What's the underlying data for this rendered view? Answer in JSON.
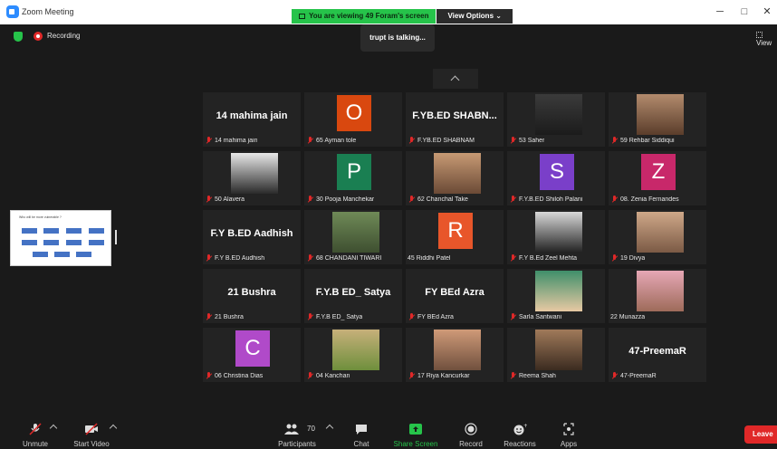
{
  "window": {
    "title": "Zoom Meeting",
    "viewing_text": "You are viewing 49 Foram's screen",
    "view_options_label": "View Options ⌄",
    "minimize": "─",
    "maximize": "□",
    "close": "✕"
  },
  "meeting": {
    "recording_label": "Recording",
    "view_label": "View",
    "talking_text": "trupt is talking..."
  },
  "shared_screen": {
    "slide_title": "Who will be more vulnerable ?"
  },
  "tiles": [
    {
      "type": "name",
      "display": "14 mahima jain",
      "label": "14 mahima jain"
    },
    {
      "type": "avatar",
      "letter": "O",
      "color": "#d9480f",
      "label": "65 Ayman tole"
    },
    {
      "type": "name",
      "display": "F.YB.ED SHABN...",
      "label": "F.YB.ED SHABNAM"
    },
    {
      "type": "photo",
      "photo_colors": [
        "#3b3b3b",
        "#1b1b1b"
      ],
      "label": "53 Saher"
    },
    {
      "type": "photo",
      "photo_colors": [
        "#b38b6d",
        "#5a3d2b"
      ],
      "label": "59 Rehbar Siddiqui"
    },
    {
      "type": "photo",
      "photo_colors": [
        "#e8e8e8",
        "#2a2a2a"
      ],
      "label": "50 Alavera"
    },
    {
      "type": "avatar",
      "letter": "P",
      "color": "#1a7f52",
      "label": "30 Pooja Manchekar"
    },
    {
      "type": "photo",
      "photo_colors": [
        "#c79a74",
        "#6b4a36"
      ],
      "label": "62 Chanchal Take"
    },
    {
      "type": "avatar",
      "letter": "S",
      "color": "#7a3fc9",
      "label": "F.Y.B.ED Shiloh Palani"
    },
    {
      "type": "avatar",
      "letter": "Z",
      "color": "#c8286a",
      "label": "08. Zenia Fernandes"
    },
    {
      "type": "name",
      "display": "F.Y B.ED Aadhish",
      "label": "F.Y B.ED Audhish"
    },
    {
      "type": "photo",
      "photo_colors": [
        "#6f8a57",
        "#3e4f30"
      ],
      "label": "68 CHANDANI TIWARI"
    },
    {
      "type": "avatar",
      "letter": "R",
      "color": "#e8562a",
      "label": "45 Riddhi Patel",
      "muted": false
    },
    {
      "type": "photo",
      "photo_colors": [
        "#d8d8d8",
        "#222222"
      ],
      "label": "F.Y B.Ed Zeel Mehta"
    },
    {
      "type": "photo",
      "photo_colors": [
        "#cfa889",
        "#7b5a45"
      ],
      "label": "19 Divya"
    },
    {
      "type": "name",
      "display": "21 Bushra",
      "label": "21 Bushra"
    },
    {
      "type": "name",
      "display": "F.Y.B ED_ Satya",
      "label": "F.Y.B ED_ Satya"
    },
    {
      "type": "name",
      "display": "FY BEd Azra",
      "label": "FY BEd Azra"
    },
    {
      "type": "photo",
      "photo_colors": [
        "#3f8f6a",
        "#e7c9a3"
      ],
      "label": "Sarla Santwani"
    },
    {
      "type": "photo",
      "photo_colors": [
        "#e6a7b5",
        "#9e6b5a"
      ],
      "label": "22 Munazza",
      "muted": false
    },
    {
      "type": "avatar",
      "letter": "C",
      "color": "#b04ac9",
      "label": "06 Christina Dias"
    },
    {
      "type": "photo",
      "photo_colors": [
        "#c7b07a",
        "#6e8f3c"
      ],
      "label": "04 Kanchan"
    },
    {
      "type": "photo",
      "photo_colors": [
        "#cf9a78",
        "#70503e"
      ],
      "label": "17 Riya Kancurkar"
    },
    {
      "type": "photo",
      "photo_colors": [
        "#a07a5a",
        "#3b2b20"
      ],
      "label": "Reema Shah"
    },
    {
      "type": "name",
      "display": "47-PreemaR",
      "label": "47-PreemaR"
    }
  ],
  "toolbar": {
    "unmute": "Unmute",
    "start_video": "Start Video",
    "participants": "Participants",
    "participants_count": "70",
    "chat": "Chat",
    "share_screen": "Share Screen",
    "record": "Record",
    "reactions": "Reactions",
    "apps": "Apps",
    "leave": "Leave"
  },
  "colors": {
    "accent_green": "#26c34a",
    "leave_red": "#e02828",
    "background": "#1a1a1a"
  }
}
